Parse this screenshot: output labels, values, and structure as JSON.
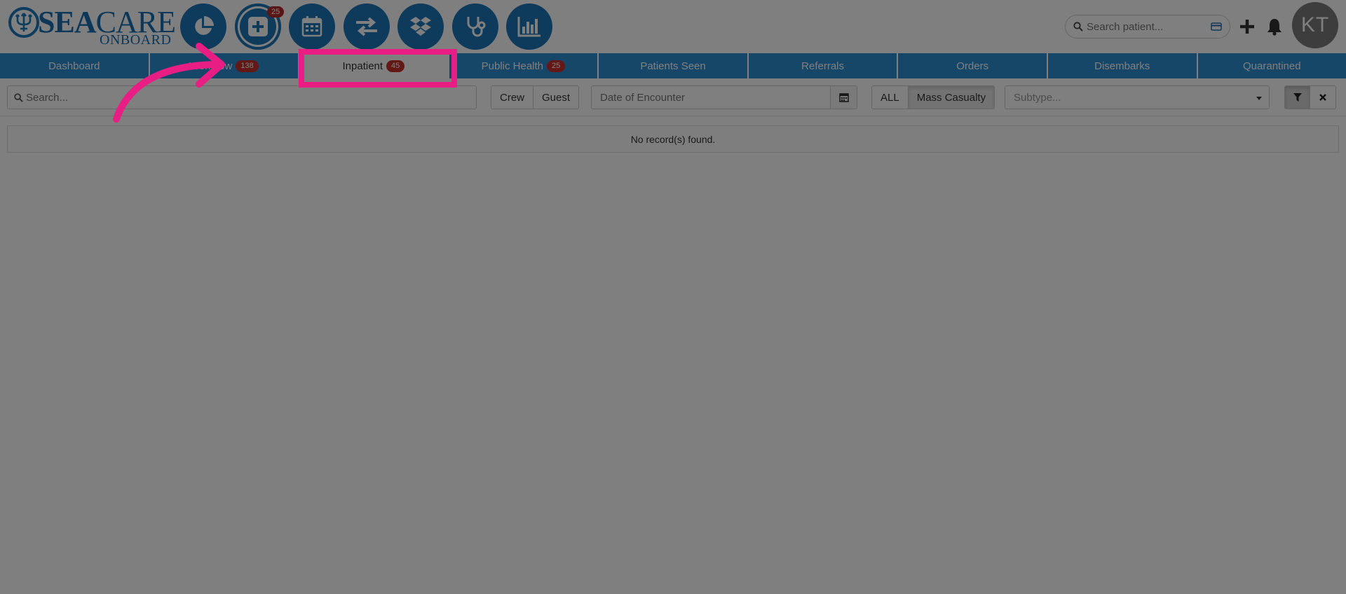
{
  "brand": {
    "name_sea": "SEA",
    "name_care": "CARE",
    "subtitle": "ONBOARD"
  },
  "quick_actions": [
    {
      "icon": "pie-chart-icon"
    },
    {
      "icon": "plus-square-icon",
      "badge": "25"
    },
    {
      "icon": "calendar-icon"
    },
    {
      "icon": "swap-arrows-icon"
    },
    {
      "icon": "dropbox-icon"
    },
    {
      "icon": "stethoscope-icon"
    },
    {
      "icon": "bar-chart-icon"
    }
  ],
  "header": {
    "search_placeholder": "Search patient...",
    "avatar_initials": "KT"
  },
  "tabs": [
    {
      "label": "Dashboard"
    },
    {
      "label": "Workflow",
      "badge": "138"
    },
    {
      "label": "Inpatient",
      "badge": "45",
      "active": true
    },
    {
      "label": "Public Health",
      "badge": "25"
    },
    {
      "label": "Patients Seen"
    },
    {
      "label": "Referrals"
    },
    {
      "label": "Orders"
    },
    {
      "label": "Disembarks"
    },
    {
      "label": "Quarantined"
    }
  ],
  "filters": {
    "search_placeholder": "Search...",
    "population": [
      "Crew",
      "Guest"
    ],
    "date_placeholder": "Date of Encounter",
    "scope": [
      "ALL",
      "Mass Casualty"
    ],
    "scope_active": "Mass Casualty",
    "subtype_placeholder": "Subtype..."
  },
  "content": {
    "empty_message": "No record(s) found."
  },
  "colors": {
    "primary": "#2d8fd2",
    "circle": "#1c75b7",
    "badge": "#c9302c",
    "highlight": "#e91e84"
  }
}
